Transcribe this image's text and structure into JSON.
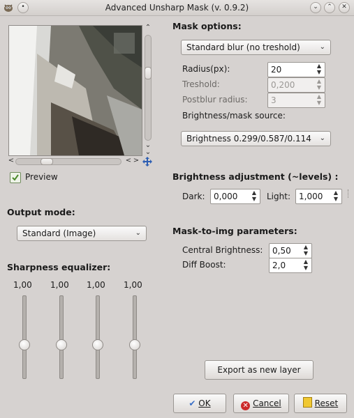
{
  "window": {
    "title": "Advanced Unsharp Mask (v. 0.9.2)",
    "app_icon": "gimp-icon",
    "pin_icon": "pin-icon",
    "controls": [
      "chevron-down-icon",
      "chevron-up-icon",
      "close-icon"
    ]
  },
  "preview": {
    "checkbox_label": "Preview",
    "checked": true,
    "navigate_icon": "move-arrows-icon"
  },
  "output_mode": {
    "heading": "Output mode:",
    "selected": "Standard (Image)"
  },
  "sharpness": {
    "heading": "Sharpness equalizer:",
    "sliders": [
      {
        "value_label": "1,00",
        "level": 0.5
      },
      {
        "value_label": "1,00",
        "level": 0.5
      },
      {
        "value_label": "1,00",
        "level": 0.5
      },
      {
        "value_label": "1,00",
        "level": 0.5
      }
    ]
  },
  "mask_options": {
    "heading": "Mask options:",
    "blur_mode": "Standard blur (no treshold)",
    "radius_label": "Radius(px):",
    "radius_value": "20",
    "treshold_label": "Treshold:",
    "treshold_value": "0,200",
    "postblur_label": "Postblur radius:",
    "postblur_value": "3",
    "source_label": "Brightness/mask source:",
    "source_selected": "Brightness 0.299/0.587/0.114"
  },
  "brightness_adjustment": {
    "heading": "Brightness adjustment (~levels) :",
    "dark_label": "Dark:",
    "dark_value": "0,000",
    "light_label": "Light:",
    "light_value": "1,000"
  },
  "mask_to_img": {
    "heading": "Mask-to-img parameters:",
    "central_label": "Central Brightness:",
    "central_value": "0,50",
    "diff_label": "Diff Boost:",
    "diff_value": "2,0"
  },
  "buttons": {
    "export": "Export as new layer",
    "ok": "OK",
    "cancel": "Cancel",
    "reset": "Reset"
  },
  "colors": {
    "background": "#d6d2d0",
    "preview_check": "#4a8a2a",
    "ok_icon": "#3a6fc7",
    "cancel_icon": "#cc2a2a",
    "reset_icon": "#f0c832"
  }
}
